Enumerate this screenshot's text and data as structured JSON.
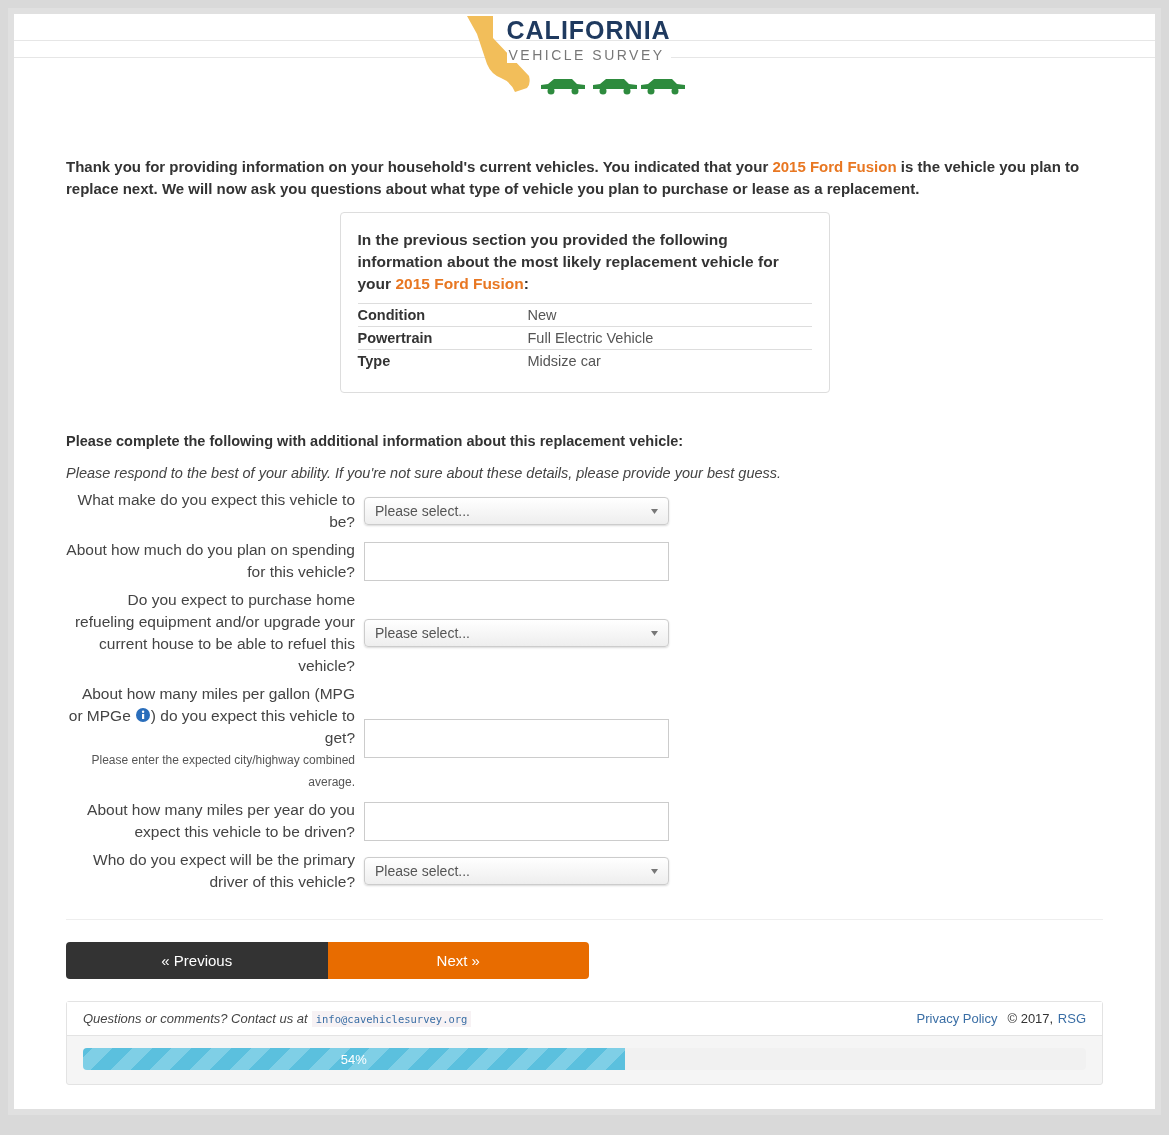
{
  "logo": {
    "title": "CALIFORNIA",
    "subtitle": "VEHICLE SURVEY"
  },
  "intro": "Thank you for providing information on your household's current vehicles. You indicated that your **2015 Ford Fusion** is the vehicle you plan to replace next. We will now ask you questions about what type of vehicle you plan to purchase or lease as a replacement.",
  "summary": {
    "text": "In the previous section you provided the following information about the most likely replacement vehicle for your **2015 Ford Fusion**:",
    "rows": [
      {
        "label": "Condition",
        "value": "New"
      },
      {
        "label": "Powertrain",
        "value": "Full Electric Vehicle"
      },
      {
        "label": "Type",
        "value": "Midsize car"
      }
    ]
  },
  "section_heading": "Please complete the following with additional information about this replacement vehicle:",
  "instructions": "Please respond to the best of your ability. If you're not sure about these details, please provide your best guess.",
  "questions": [
    {
      "kind": "select",
      "label": "What make do you expect this vehicle to be?",
      "placeholder": "Please select..."
    },
    {
      "kind": "text",
      "label": "About how much do you plan on spending for this vehicle?"
    },
    {
      "kind": "select",
      "label": "Do you expect to purchase home refueling equipment and/or upgrade your current house to be able to refuel this vehicle?",
      "placeholder": "Please select..."
    },
    {
      "kind": "text",
      "label": "About how many miles per gallon (MPG or MPGe",
      "label_tail": ") do you expect this vehicle to get?",
      "hint": "Please enter the expected city/highway combined average."
    },
    {
      "kind": "text",
      "label": "About how many miles per year do you expect this vehicle to be driven?"
    },
    {
      "kind": "select",
      "label": "Who do you expect will be the primary driver of this vehicle?",
      "placeholder": "Please select..."
    }
  ],
  "buttons": {
    "previous": "« Previous",
    "next": "Next »"
  },
  "footer": {
    "contact": "Questions or comments? Contact us at",
    "email": "info@cavehiclesurvey.org",
    "privacy": "Privacy Policy",
    "copyright": "© 2017,",
    "company": "RSG"
  },
  "progress": {
    "level": 0.54,
    "label": "54%"
  }
}
